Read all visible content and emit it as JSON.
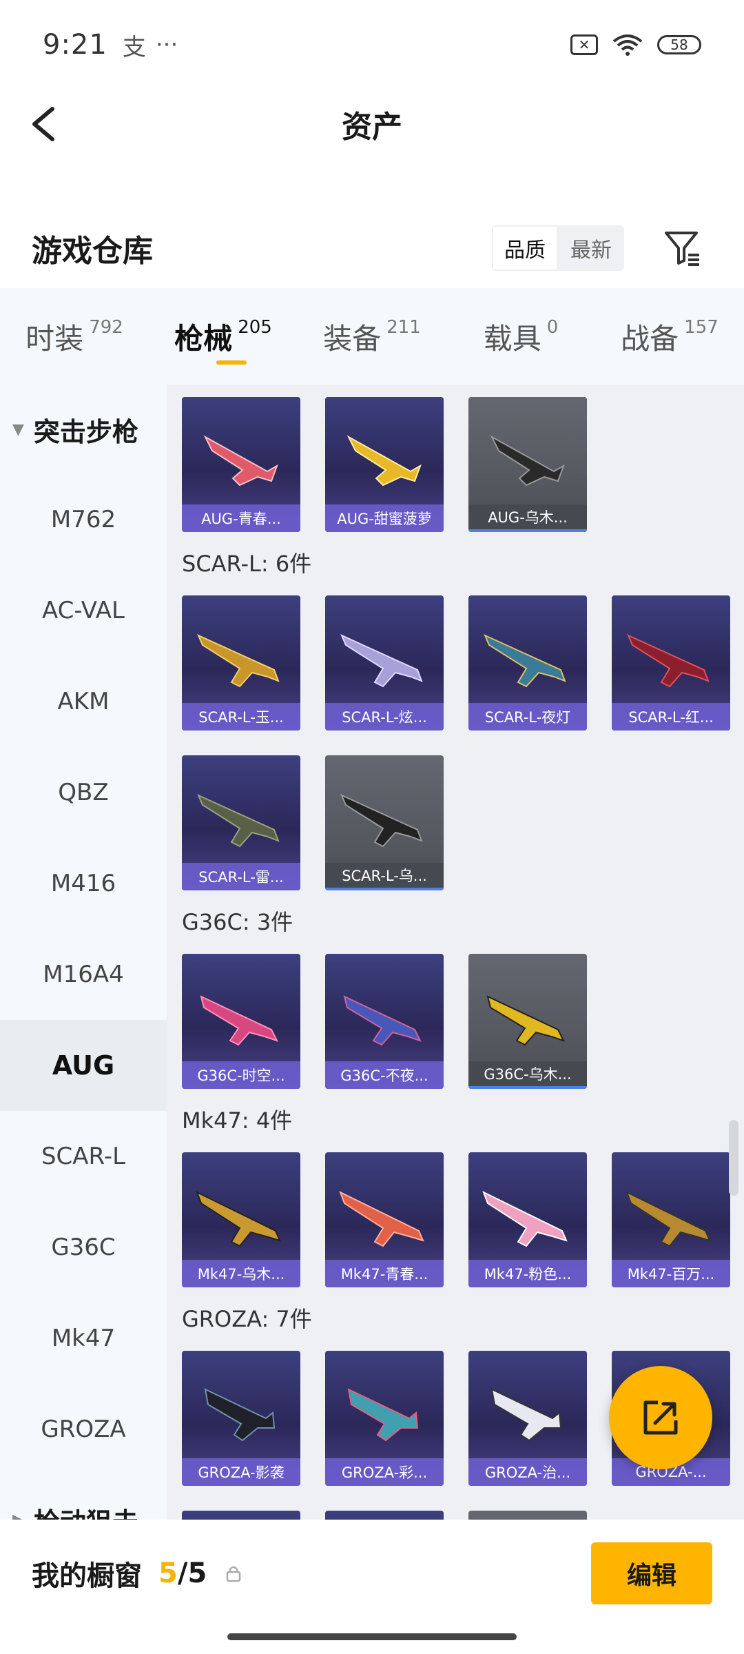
{
  "status": {
    "time": "9:21",
    "app_glyph": "支",
    "dots": "···",
    "battery": "58"
  },
  "header": {
    "title": "资产"
  },
  "warehouse": {
    "title": "游戏仓库",
    "sort_options": [
      "品质",
      "最新"
    ],
    "active_sort": "品质"
  },
  "tabs": [
    {
      "name": "时装",
      "count": "792"
    },
    {
      "name": "枪械",
      "count": "205",
      "active": true
    },
    {
      "name": "装备",
      "count": "211"
    },
    {
      "name": "载具",
      "count": "0"
    },
    {
      "name": "战备",
      "count": "157"
    }
  ],
  "sidebar": {
    "group1": "突击步枪",
    "items": [
      "M762",
      "AC-VAL",
      "AKM",
      "QBZ",
      "M416",
      "M16A4",
      "AUG",
      "SCAR-L",
      "G36C",
      "Mk47",
      "GROZA"
    ],
    "active": "AUG",
    "group2": "枪动狙击"
  },
  "sections": {
    "aug": {
      "label": "",
      "items": [
        "AUG-青春...",
        "AUG-甜蜜菠萝",
        "AUG-乌木..."
      ]
    },
    "scar": {
      "label": "SCAR-L: 6件",
      "items": [
        "SCAR-L-玉...",
        "SCAR-L-炫...",
        "SCAR-L-夜灯",
        "SCAR-L-红...",
        "SCAR-L-雷...",
        "SCAR-L-乌..."
      ]
    },
    "g36c": {
      "label": "G36C: 3件",
      "items": [
        "G36C-时空...",
        "G36C-不夜...",
        "G36C-乌木..."
      ]
    },
    "mk47": {
      "label": "Mk47: 4件",
      "items": [
        "Mk47-乌木...",
        "Mk47-青春...",
        "Mk47-粉色...",
        "Mk47-百万..."
      ]
    },
    "groza": {
      "label": "GROZA: 7件",
      "items": [
        "GROZA-影袭",
        "GROZA-彩...",
        "GROZA-治...",
        "GROZA-..."
      ]
    }
  },
  "bottom": {
    "label": "我的橱窗",
    "current": "5",
    "sep": "/",
    "total": "5",
    "edit": "编辑"
  },
  "colors": {
    "accent": "#ffb400",
    "card_purple": "#2b2859",
    "card_gray": "#4d4f57"
  }
}
